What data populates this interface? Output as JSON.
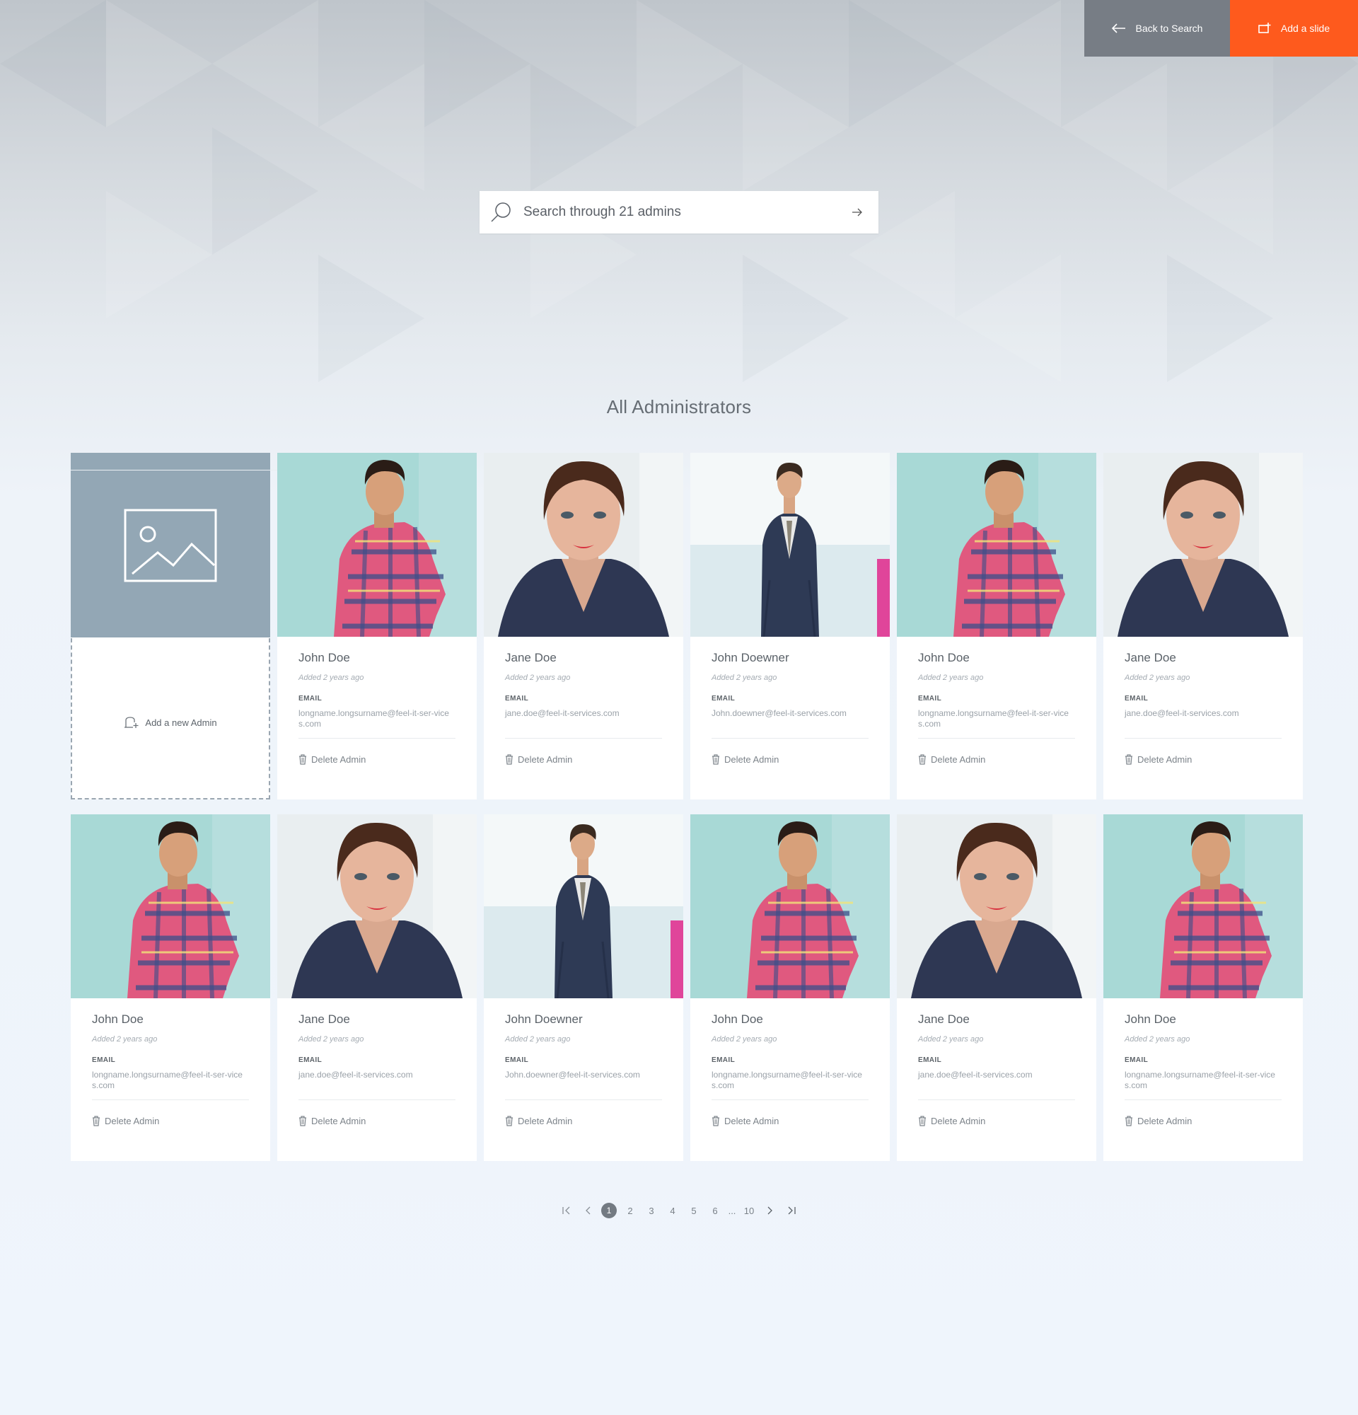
{
  "header": {
    "back_label": "Back to Search",
    "add_slide_label": "Add a slide",
    "back_color": "#777d85",
    "accent_color": "#fe5a1d"
  },
  "search": {
    "placeholder": "Search through 21 admins"
  },
  "section_title": "All Administrators",
  "add_card": {
    "label": "Add a new Admin"
  },
  "labels": {
    "email": "EMAIL",
    "delete": "Delete Admin"
  },
  "admins": [
    {
      "name": "John Doe",
      "added": "Added 2 years ago",
      "email": "longname.longsurname@feel-it-ser-vices.com",
      "photo": "man-plaid"
    },
    {
      "name": "Jane Doe",
      "added": "Added 2 years ago",
      "email": "jane.doe@feel-it-services.com",
      "photo": "woman"
    },
    {
      "name": "John Doewner",
      "added": "Added 2 years ago",
      "email": "John.doewner@feel-it-services.com",
      "photo": "man-suit"
    },
    {
      "name": "John Doe",
      "added": "Added 2 years ago",
      "email": "longname.longsurname@feel-it-ser-vices.com",
      "photo": "man-plaid"
    },
    {
      "name": "Jane Doe",
      "added": "Added 2 years ago",
      "email": "jane.doe@feel-it-services.com",
      "photo": "woman"
    },
    {
      "name": "John Doe",
      "added": "Added 2 years ago",
      "email": "longname.longsurname@feel-it-ser-vices.com",
      "photo": "man-plaid"
    },
    {
      "name": "Jane Doe",
      "added": "Added 2 years ago",
      "email": "jane.doe@feel-it-services.com",
      "photo": "woman"
    },
    {
      "name": "John Doewner",
      "added": "Added 2 years ago",
      "email": "John.doewner@feel-it-services.com",
      "photo": "man-suit"
    },
    {
      "name": "John Doe",
      "added": "Added 2 years ago",
      "email": "longname.longsurname@feel-it-ser-vices.com",
      "photo": "man-plaid"
    },
    {
      "name": "Jane Doe",
      "added": "Added 2 years ago",
      "email": "jane.doe@feel-it-services.com",
      "photo": "woman"
    },
    {
      "name": "John Doe",
      "added": "Added 2 years ago",
      "email": "longname.longsurname@feel-it-ser-vices.com",
      "photo": "man-plaid"
    }
  ],
  "pagination": {
    "pages": [
      "1",
      "2",
      "3",
      "4",
      "5",
      "6"
    ],
    "ellipsis": "...",
    "last": "10",
    "current": "1"
  }
}
